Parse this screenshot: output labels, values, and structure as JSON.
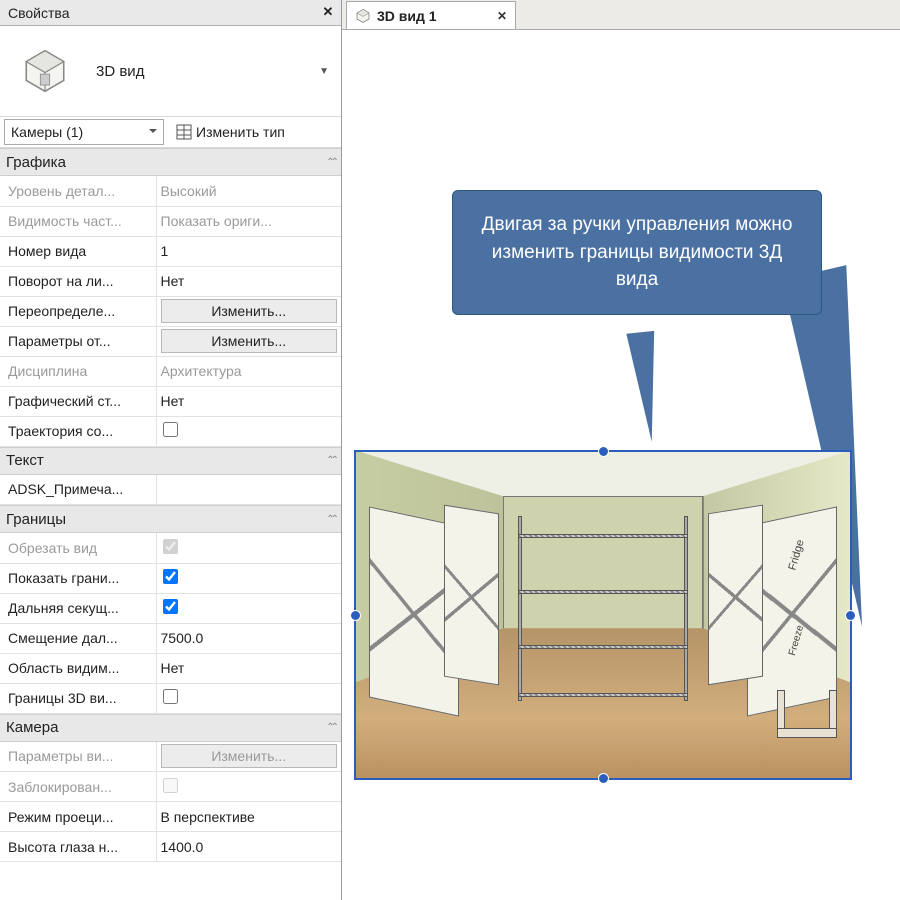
{
  "panel": {
    "title": "Свойства",
    "type_label": "3D вид",
    "instance_selector": "Камеры (1)",
    "edit_type_label": "Изменить тип"
  },
  "groups": {
    "graphics": {
      "title": "Графика",
      "rows": {
        "detail_level_label": "Уровень детал...",
        "detail_level_value": "Высокий",
        "visibility_label": "Видимость част...",
        "visibility_value": "Показать ориги...",
        "view_number_label": "Номер вида",
        "view_number_value": "1",
        "rotation_label": "Поворот на ли...",
        "rotation_value": "Нет",
        "overrides_label": "Переопределе...",
        "overrides_btn": "Изменить...",
        "display_params_label": "Параметры от...",
        "display_params_btn": "Изменить...",
        "discipline_label": "Дисциплина",
        "discipline_value": "Архитектура",
        "graphic_style_label": "Графический ст...",
        "graphic_style_value": "Нет",
        "sun_path_label": "Траектория со..."
      }
    },
    "text": {
      "title": "Текст",
      "note_label": "ADSK_Примеча..."
    },
    "boundaries": {
      "title": "Границы",
      "crop_view_label": "Обрезать вид",
      "show_crop_label": "Показать грани...",
      "far_clip_label": "Дальняя секущ...",
      "far_offset_label": "Смещение дал...",
      "far_offset_value": "7500.0",
      "visible_area_label": "Область видим...",
      "visible_area_value": "Нет",
      "bounds3d_label": "Границы 3D ви..."
    },
    "camera": {
      "title": "Камера",
      "view_params_label": "Параметры ви...",
      "view_params_btn": "Изменить...",
      "locked_label": "Заблокирован...",
      "projection_label": "Режим проеци...",
      "projection_value": "В перспективе",
      "eye_height_label": "Высота глаза н...",
      "eye_height_value": "1400.0"
    }
  },
  "view_tab": {
    "title": "3D вид 1"
  },
  "callout": {
    "text": "Двигая за ручки управления можно изменить границы видимости 3Д вида"
  },
  "room_labels": {
    "fridge": "Fridge",
    "freeze": "Freeze"
  }
}
